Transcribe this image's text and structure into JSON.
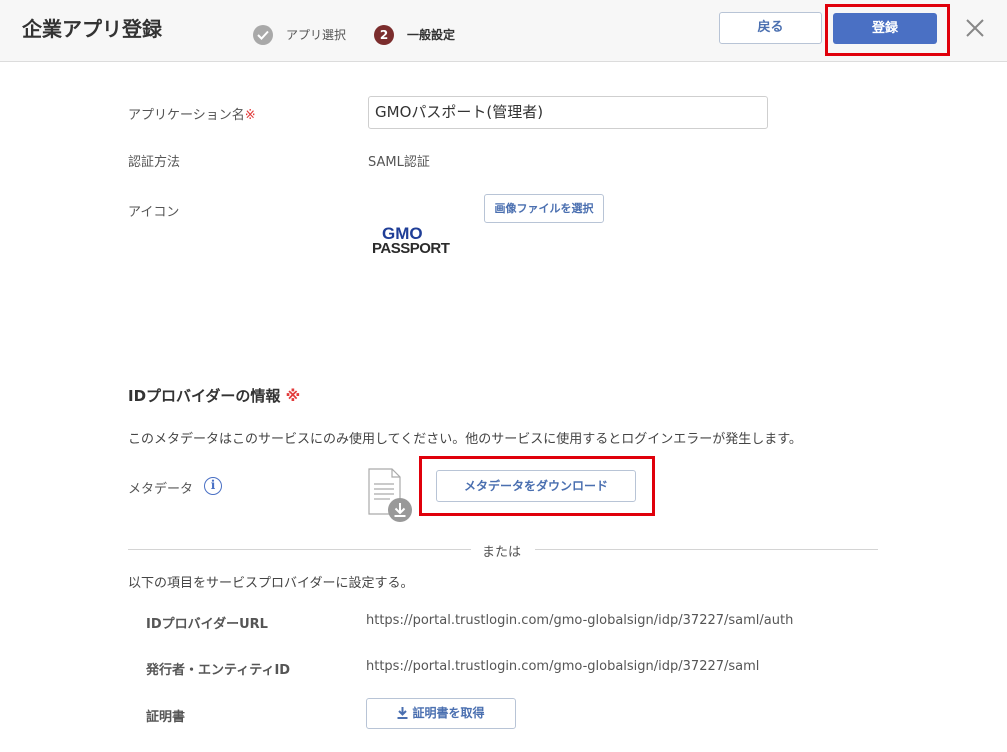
{
  "header": {
    "title": "企業アプリ登録",
    "steps": [
      {
        "number": "✓",
        "label": "アプリ選択",
        "state": "done"
      },
      {
        "number": "2",
        "label": "一般設定",
        "state": "current"
      }
    ],
    "back_label": "戻る",
    "register_label": "登録"
  },
  "form": {
    "app_name_label": "アプリケーション名",
    "required_mark": "※",
    "app_name_value": "GMOパスポート(管理者)",
    "auth_method_label": "認証方法",
    "auth_method_value": "SAML認証",
    "icon_label": "アイコン",
    "select_image_label": "画像ファイルを選択",
    "logo_line1": "GMO",
    "logo_line2": "PASSPORT"
  },
  "idp": {
    "title": "IDプロバイダーの情報",
    "required_mark": "※",
    "description": "このメタデータはこのサービスにのみ使用してください。他のサービスに使用するとログインエラーが発生します。",
    "metadata_label": "メタデータ",
    "download_label": "メタデータをダウンロード",
    "or_label": "または",
    "instruction": "以下の項目をサービスプロバイダーに設定する。",
    "rows": [
      {
        "label": "IDプロバイダーURL",
        "value": "https://portal.trustlogin.com/gmo-globalsign/idp/37227/saml/auth"
      },
      {
        "label": "発行者・エンティティID",
        "value": "https://portal.trustlogin.com/gmo-globalsign/idp/37227/saml"
      },
      {
        "label": "証明書",
        "value": ""
      }
    ],
    "cert_button_label": "証明書を取得"
  },
  "colors": {
    "accent": "#4a70c4",
    "highlight": "#e0000b",
    "step_current": "#7b2d2d",
    "step_done": "#a9a9a9",
    "required": "#e23b3b"
  },
  "icons": [
    "check-icon",
    "close-icon",
    "document-download-icon",
    "info-icon",
    "download-icon"
  ]
}
